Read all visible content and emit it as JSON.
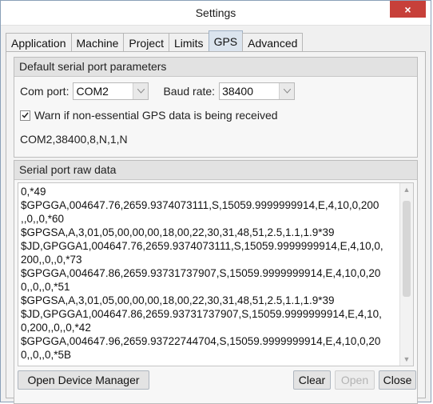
{
  "window": {
    "title": "Settings",
    "close_glyph": "×"
  },
  "tabs": [
    {
      "label": "Application"
    },
    {
      "label": "Machine"
    },
    {
      "label": "Project"
    },
    {
      "label": "Limits"
    },
    {
      "label": "GPS"
    },
    {
      "label": "Advanced"
    }
  ],
  "active_tab": "GPS",
  "serial_params": {
    "header": "Default serial port parameters",
    "com_port_label": "Com port:",
    "com_port_value": "COM2",
    "baud_rate_label": "Baud rate:",
    "baud_rate_value": "38400",
    "warn_checked": true,
    "warn_label": "Warn if non-essential GPS data is being received",
    "summary": "COM2,38400,8,N,1,N"
  },
  "raw_data": {
    "header": "Serial port raw data",
    "lines": [
      "0,*49",
      "$GPGGA,004647.76,2659.9374073111,S,15059.9999999914,E,4,10,0,200",
      ",,0,,0,*60",
      "$GPGSA,A,3,01,05,00,00,00,18,00,22,30,31,48,51,2.5,1.1,1.9*39",
      "$JD,GPGGA1,004647.76,2659.9374073111,S,15059.9999999914,E,4,10,0,",
      "200,,0,,0,*73",
      "$GPGGA,004647.86,2659.93731737907,S,15059.9999999914,E,4,10,0,20",
      "0,,0,,0,*51",
      "$GPGSA,A,3,01,05,00,00,00,18,00,22,30,31,48,51,2.5,1.1,1.9*39",
      "$JD,GPGGA1,004647.86,2659.93731737907,S,15059.9999999914,E,4,10,",
      "0,200,,0,,0,*42",
      "$GPGGA,004647.96,2659.93722744704,S,15059.9999999914,E,4,10,0,20",
      "0,,0,,0,*5B"
    ]
  },
  "buttons": {
    "open_device_manager": "Open Device Manager",
    "clear": "Clear",
    "open": "Open",
    "close": "Close"
  },
  "colors": {
    "title_close_bg": "#c7403a",
    "active_tab_bg": "#dbe4ee"
  }
}
